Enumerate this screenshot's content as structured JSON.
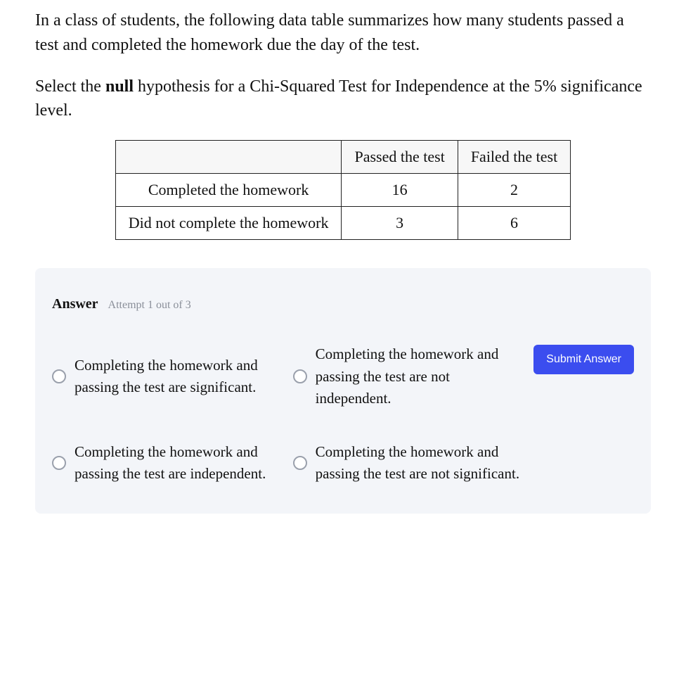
{
  "prompt": {
    "paragraph1": "In a class of students, the following data table summarizes how many students passed a test and completed the homework due the day of the test.",
    "paragraph2_pre": "Select the ",
    "paragraph2_bold": "null",
    "paragraph2_post": " hypothesis for a Chi-Squared Test for Independence at the 5% significance level."
  },
  "table": {
    "col_headers": [
      "Passed the test",
      "Failed the test"
    ],
    "rows": [
      {
        "label": "Completed the homework",
        "values": [
          "16",
          "2"
        ]
      },
      {
        "label": "Did not complete the homework",
        "values": [
          "3",
          "6"
        ]
      }
    ]
  },
  "answer": {
    "label": "Answer",
    "attempt": "Attempt 1 out of 3",
    "options": [
      "Completing the homework and passing the test are significant.",
      "Completing the homework and passing the test are not independent.",
      "Completing the homework and passing the test are independent.",
      "Completing the homework and passing the test are not significant."
    ],
    "submit": "Submit Answer"
  },
  "chart_data": {
    "type": "table",
    "columns": [
      "",
      "Passed the test",
      "Failed the test"
    ],
    "rows": [
      [
        "Completed the homework",
        16,
        2
      ],
      [
        "Did not complete the homework",
        3,
        6
      ]
    ],
    "title": ""
  }
}
